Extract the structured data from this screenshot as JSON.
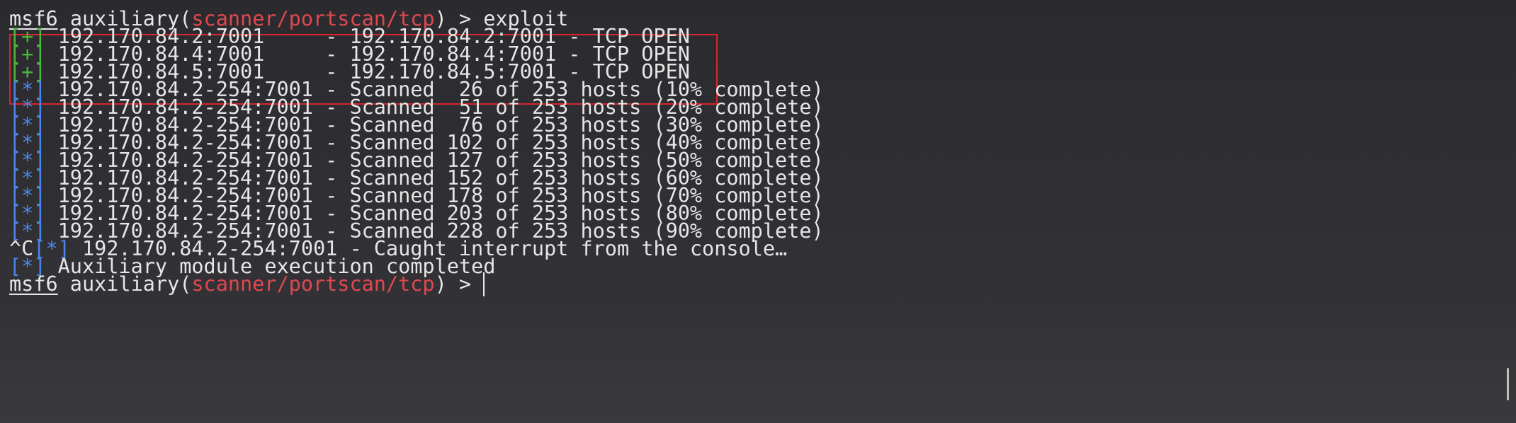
{
  "prompt": {
    "msf": "msf6",
    "module_prefix": "auxiliary(",
    "module_path": "scanner/portscan/tcp",
    "module_suffix": ") > ",
    "command": "exploit"
  },
  "open_results": [
    {
      "marker": "[+]",
      "text": " 192.170.84.2:7001     - 192.170.84.2:7001 - TCP OPEN"
    },
    {
      "marker": "[+]",
      "text": " 192.170.84.4:7001     - 192.170.84.4:7001 - TCP OPEN"
    },
    {
      "marker": "[+]",
      "text": " 192.170.84.5:7001     - 192.170.84.5:7001 - TCP OPEN"
    }
  ],
  "progress_lines": [
    {
      "marker": "[*]",
      "text": " 192.170.84.2-254:7001 - Scanned  26 of 253 hosts (10% complete)"
    },
    {
      "marker": "[*]",
      "text": " 192.170.84.2-254:7001 - Scanned  51 of 253 hosts (20% complete)"
    },
    {
      "marker": "[*]",
      "text": " 192.170.84.2-254:7001 - Scanned  76 of 253 hosts (30% complete)"
    },
    {
      "marker": "[*]",
      "text": " 192.170.84.2-254:7001 - Scanned 102 of 253 hosts (40% complete)"
    },
    {
      "marker": "[*]",
      "text": " 192.170.84.2-254:7001 - Scanned 127 of 253 hosts (50% complete)"
    },
    {
      "marker": "[*]",
      "text": " 192.170.84.2-254:7001 - Scanned 152 of 253 hosts (60% complete)"
    },
    {
      "marker": "[*]",
      "text": " 192.170.84.2-254:7001 - Scanned 178 of 253 hosts (70% complete)"
    },
    {
      "marker": "[*]",
      "text": " 192.170.84.2-254:7001 - Scanned 203 of 253 hosts (80% complete)"
    },
    {
      "marker": "[*]",
      "text": " 192.170.84.2-254:7001 - Scanned 228 of 253 hosts (90% complete)"
    }
  ],
  "interrupt_line": {
    "prefix": "^C",
    "marker": "[*]",
    "text": " 192.170.84.2-254:7001 - Caught interrupt from the console…"
  },
  "completed_line": {
    "marker": "[*]",
    "text": " Auxiliary module execution completed"
  },
  "final_prompt": {
    "msf": "msf6",
    "module_prefix": " auxiliary(",
    "module_path": "scanner/portscan/tcp",
    "module_suffix": ") > "
  },
  "colors": {
    "background": "#2f2f33",
    "text": "#e6e6e6",
    "module_path": "#e0484f",
    "success_marker": "#48b83c",
    "info_marker": "#4a86e8",
    "highlight_box": "#d8262d"
  }
}
